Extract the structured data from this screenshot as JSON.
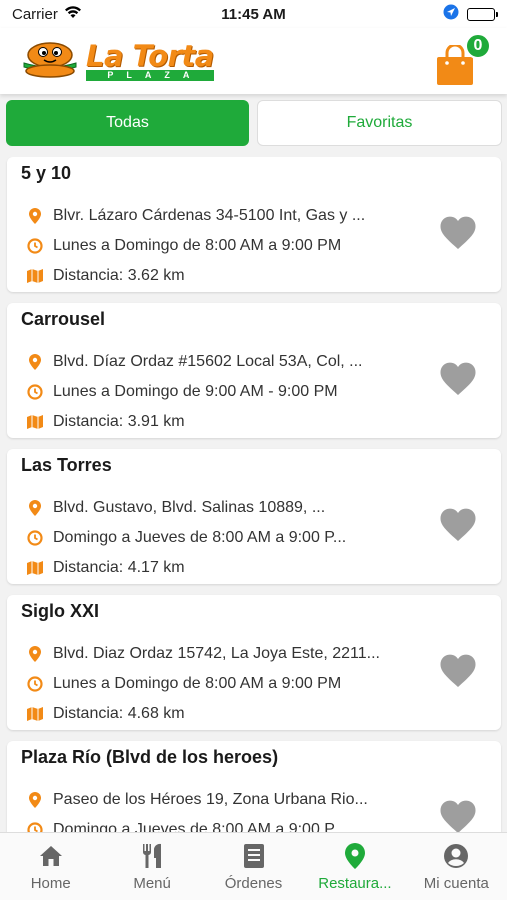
{
  "status_bar": {
    "carrier": "Carrier",
    "time": "11:45 AM"
  },
  "header": {
    "logo_title": "La Torta",
    "logo_subtitle": "PLAZA",
    "cart_count": "0",
    "brand_orange": "#f28a16",
    "brand_green": "#1faa3a"
  },
  "segments": {
    "all_label": "Todas",
    "favorites_label": "Favoritas"
  },
  "restaurants": [
    {
      "name": "5 y 10",
      "address": "Blvr. Lázaro Cárdenas 34-5100 Int, Gas y ...",
      "hours": "Lunes a Domingo de 8:00 AM a 9:00 PM",
      "distance": "Distancia: 3.62 km"
    },
    {
      "name": "Carrousel",
      "address": "Blvd. Díaz Ordaz #15602 Local 53A, Col, ...",
      "hours": "Lunes a Domingo de 9:00 AM - 9:00 PM",
      "distance": "Distancia: 3.91 km"
    },
    {
      "name": "Las Torres",
      "address": "Blvd. Gustavo, Blvd. Salinas 10889, ...",
      "hours": "Domingo a Jueves de 8:00 AM a 9:00 P...",
      "distance": "Distancia: 4.17 km"
    },
    {
      "name": "Siglo XXI",
      "address": "Blvd. Diaz Ordaz 15742, La Joya Este, 2211...",
      "hours": "Lunes a Domingo de 8:00 AM a 9:00 PM",
      "distance": "Distancia: 4.68 km"
    },
    {
      "name": "Plaza Río (Blvd de los heroes)",
      "address": "Paseo de los Héroes 19, Zona Urbana Rio...",
      "hours": "Domingo a Jueves de 8:00 AM a 9:00 P...",
      "distance": ""
    }
  ],
  "tabbar": {
    "home": "Home",
    "menu": "Menú",
    "orders": "Órdenes",
    "restaurants": "Restaura...",
    "account": "Mi cuenta"
  }
}
